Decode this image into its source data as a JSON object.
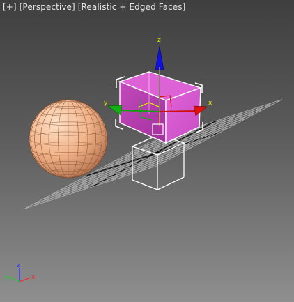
{
  "viewport": {
    "label_parts": [
      "[+]",
      "[Perspective]",
      "[Realistic + Edged Faces]"
    ]
  },
  "gizmo": {
    "x": "x",
    "y": "y",
    "z": "z"
  },
  "axis_tripod": {
    "x": "x",
    "y": "y",
    "z": "z"
  },
  "colors": {
    "background_top": "#3f3f3f",
    "background_bottom": "#8f8f8f",
    "grid": "#b0b0b0",
    "grid_axis": "#111111",
    "sphere": "#f2b48a",
    "box_selected": "#c848c0",
    "box_wire": "#ffffff",
    "selection_brackets": "#ffffff",
    "axis_x": "#e01010",
    "axis_y": "#10b010",
    "axis_z": "#1010e0",
    "gizmo_plane": "#ffff00"
  }
}
